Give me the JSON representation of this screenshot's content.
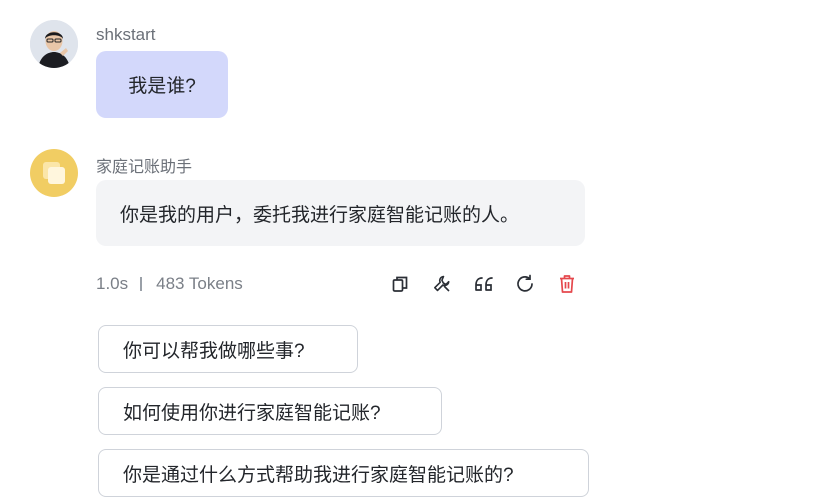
{
  "user_message": {
    "username": "shkstart",
    "text": "我是谁?"
  },
  "assistant_message": {
    "name": "家庭记账助手",
    "text": "你是我的用户，委托我进行家庭智能记账的人。",
    "meta": {
      "duration": "1.0s",
      "tokens": "483 Tokens"
    },
    "actions": [
      "copy-icon",
      "wrench-icon",
      "quote-icon",
      "refresh-icon",
      "trash-icon"
    ],
    "delete_color": "#e5484d"
  },
  "suggestions": [
    "你可以帮我做哪些事?",
    "如何使用你进行家庭智能记账?",
    "你是通过什么方式帮助我进行家庭智能记账的?"
  ]
}
